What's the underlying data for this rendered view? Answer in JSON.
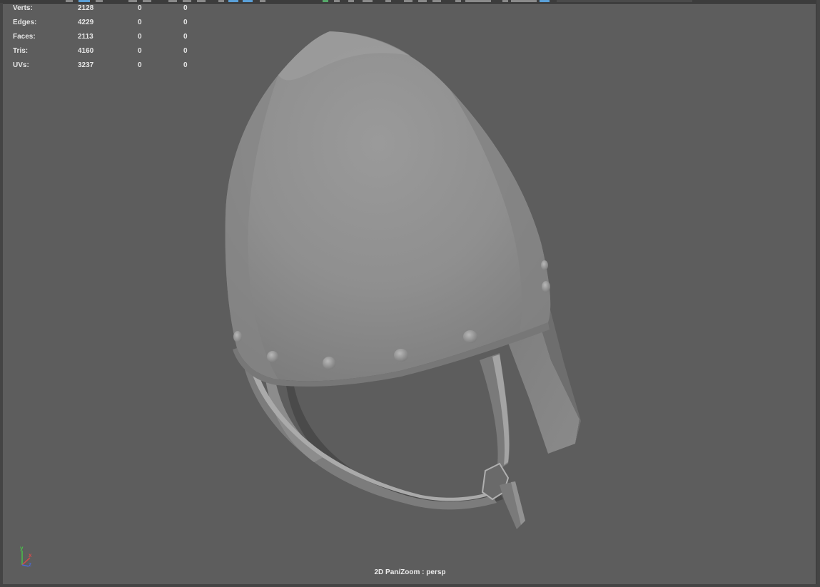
{
  "hud": {
    "rows": [
      {
        "label": "Verts:",
        "values": [
          "2128",
          "0",
          "0"
        ]
      },
      {
        "label": "Edges:",
        "values": [
          "4229",
          "0",
          "0"
        ]
      },
      {
        "label": "Faces:",
        "values": [
          "2113",
          "0",
          "0"
        ]
      },
      {
        "label": "Tris:",
        "values": [
          "4160",
          "0",
          "0"
        ]
      },
      {
        "label": "UVs:",
        "values": [
          "3237",
          "0",
          "0"
        ]
      }
    ]
  },
  "viewport": {
    "camera_label": "2D Pan/Zoom : persp",
    "background_color": "#5d5d5d",
    "model_color": "#8f8f8f"
  },
  "axis_gizmo": {
    "x_label": "x",
    "y_label": "y",
    "z_label": "z",
    "x_color": "#d84a4a",
    "y_color": "#4ac24a",
    "z_color": "#4a6ad8"
  }
}
